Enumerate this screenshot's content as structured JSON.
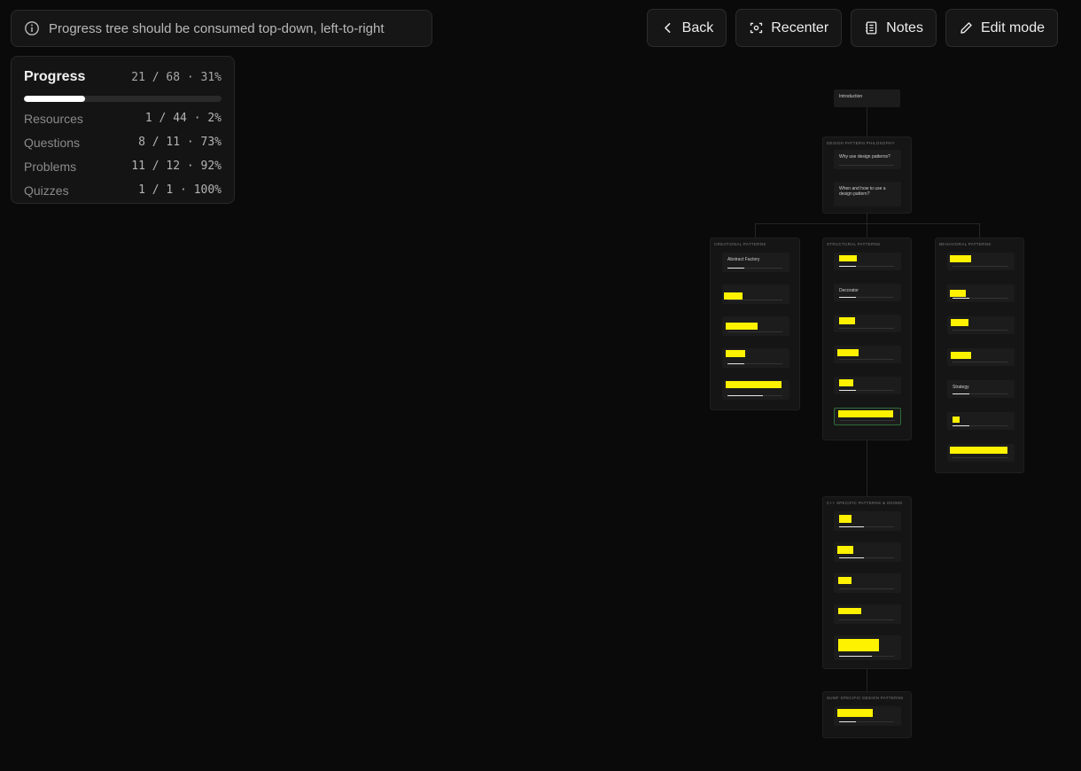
{
  "banner": {
    "text": "Progress tree should be consumed top-down, left-to-right",
    "icon": "info-icon"
  },
  "toolbar": {
    "back": "Back",
    "recenter": "Recenter",
    "notes": "Notes",
    "edit": "Edit mode"
  },
  "progress": {
    "title": "Progress",
    "total": "21 / 68 · 31%",
    "total_fraction": 0.31,
    "rows": [
      {
        "label": "Resources",
        "value": "1 / 44 · 2%"
      },
      {
        "label": "Questions",
        "value": "8 / 11 · 73%"
      },
      {
        "label": "Problems",
        "value": "11 / 12 · 92%"
      },
      {
        "label": "Quizzes",
        "value": "1 / 1 · 100%"
      }
    ]
  },
  "tree": {
    "intro": {
      "label": "Introduction"
    },
    "philosophy": {
      "title": "DESIGN PATTERN PHILOSOPHY",
      "nodes": [
        {
          "label": "Why use design patterns?"
        },
        {
          "label": "When and how to use a design pattern?"
        }
      ]
    },
    "creational": {
      "title": "CREATIONAL PATTERNS",
      "nodes": [
        {
          "label": "Abstract Factory",
          "progress": 0.3
        },
        {
          "label": "",
          "progress": 0.0
        },
        {
          "label": "",
          "progress": 0.0
        },
        {
          "label": "",
          "progress": 0.3
        },
        {
          "label": "",
          "progress": 0.65
        }
      ]
    },
    "structural": {
      "title": "STRUCTURAL PATTERNS",
      "nodes": [
        {
          "label": "",
          "progress": 0.3
        },
        {
          "label": "Decorator",
          "progress": 0.3
        },
        {
          "label": "",
          "progress": 0.0
        },
        {
          "label": "",
          "progress": 0.0
        },
        {
          "label": "",
          "progress": 0.3
        },
        {
          "label": "",
          "progress": 0.0
        }
      ]
    },
    "behavioral": {
      "title": "BEHAVIORAL PATTERNS",
      "nodes": [
        {
          "label": "",
          "progress": 0.0
        },
        {
          "label": "",
          "progress": 0.3
        },
        {
          "label": "",
          "progress": 0.0
        },
        {
          "label": "",
          "progress": 0.0
        },
        {
          "label": "Strategy",
          "progress": 0.3
        },
        {
          "label": "",
          "progress": 0.3
        },
        {
          "label": "",
          "progress": 0.0
        }
      ]
    },
    "cpp": {
      "title": "C++ SPECIFIC PATTERNS & IDIOMS",
      "nodes": [
        {
          "label": "",
          "progress": 0.45
        },
        {
          "label": "",
          "progress": 0.45
        },
        {
          "label": "",
          "progress": 0.0
        },
        {
          "label": "",
          "progress": 0.0
        },
        {
          "label": "",
          "progress": 0.6
        }
      ]
    },
    "sumf": {
      "title": "SUMF SPECIFIC DESIGN PATTERNS",
      "nodes": [
        {
          "label": "",
          "progress": 0.3
        }
      ]
    }
  }
}
